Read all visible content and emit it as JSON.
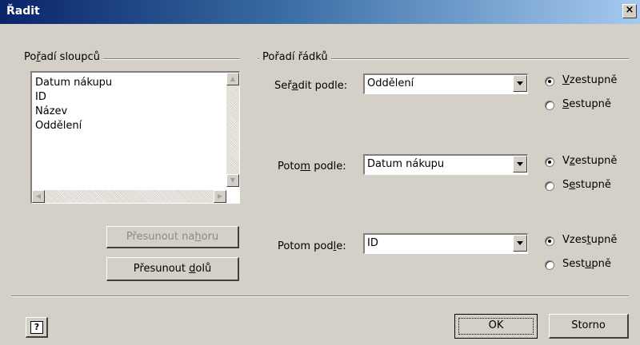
{
  "window": {
    "title": "Řadit",
    "close_label": "×"
  },
  "columns_group": {
    "label": "Pořadí sloupců",
    "items": [
      "Datum nákupu",
      "ID",
      "Název",
      "Oddělení"
    ]
  },
  "rows_group": {
    "label": "Pořadí řádků"
  },
  "buttons": {
    "move_up": "Přesunout nahoru",
    "move_down": "Přesunout dolů",
    "ok": "OK",
    "cancel": "Storno",
    "help": "?"
  },
  "sort_rows": [
    {
      "label": "Seřadit podle:",
      "value": "Oddělení",
      "order": "ascending"
    },
    {
      "label": "Potom podle:",
      "value": "Datum nákupu",
      "order": "ascending"
    },
    {
      "label": "Potom podle:",
      "value": "ID",
      "order": "ascending"
    }
  ],
  "radio_labels": {
    "ascending": "Vzestupně",
    "descending": "Sestupně"
  },
  "colors": {
    "titlebar_start": "#0a246a",
    "titlebar_end": "#a6caf0",
    "face": "#d4d0c8"
  }
}
